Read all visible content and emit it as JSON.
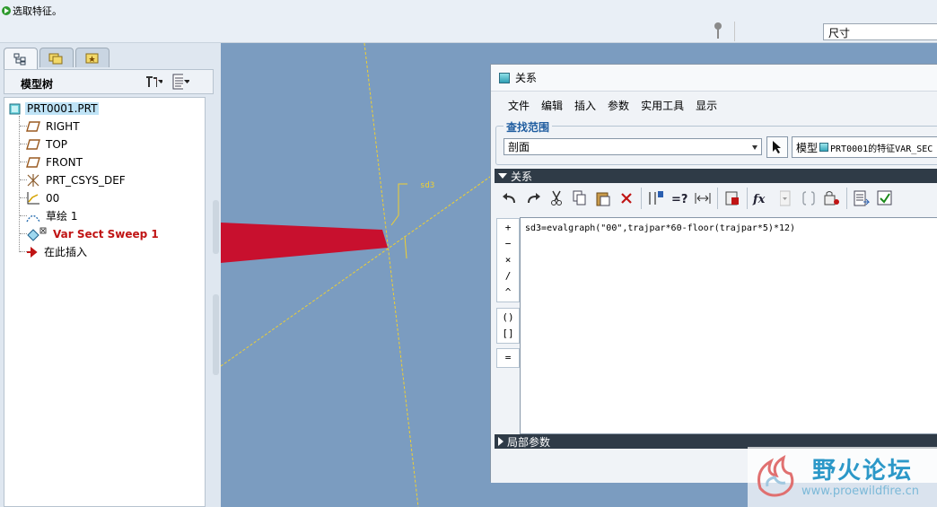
{
  "message_bar": {
    "text": "选取特征。"
  },
  "filter": {
    "value": "尺寸"
  },
  "model_tree": {
    "title": "模型树",
    "items": [
      {
        "label": "PRT0001.PRT",
        "icon": "part-icon"
      },
      {
        "label": "RIGHT",
        "icon": "datum-plane-icon"
      },
      {
        "label": "TOP",
        "icon": "datum-plane-icon"
      },
      {
        "label": "FRONT",
        "icon": "datum-plane-icon"
      },
      {
        "label": "PRT_CSYS_DEF",
        "icon": "csys-icon"
      },
      {
        "label": "00",
        "icon": "graph-icon"
      },
      {
        "label": "草绘 1",
        "icon": "sketch-icon"
      },
      {
        "label": "Var Sect Sweep 1",
        "icon": "sweep-icon"
      },
      {
        "label": "在此插入",
        "icon": "insert-here-icon"
      }
    ]
  },
  "viewport": {
    "dim_label": "sd3",
    "accent": "#c8102e",
    "datum_color": "#f0d030"
  },
  "relations_dialog": {
    "title": "关系",
    "menu": [
      "文件",
      "编辑",
      "插入",
      "参数",
      "实用工具",
      "显示"
    ],
    "look_in": {
      "title": "查找范围",
      "selected": "剖面",
      "model_label": "模型",
      "model_text": "PRT0001的特征VAR_SEC"
    },
    "relations_section": "关系",
    "operators": [
      "+",
      "−",
      "×",
      "/",
      "^",
      "()",
      "[]",
      "="
    ],
    "relation_text": "sd3=evalgraph(\"00\",trajpar*60-floor(trajpar*5)*12)",
    "local_params_section": "局部参数"
  },
  "watermark": {
    "cn": "野火论坛",
    "url": "www.proewildfire.cn"
  }
}
